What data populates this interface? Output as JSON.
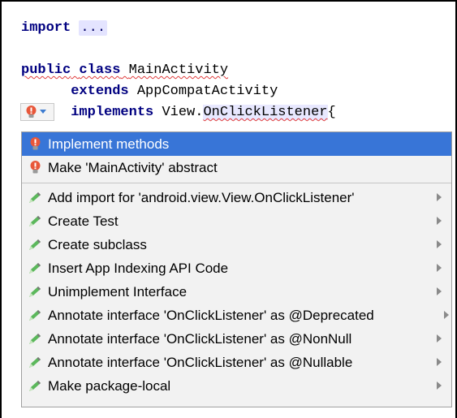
{
  "editor": {
    "line1": {
      "keyword": "import",
      "folded": "..."
    },
    "line2": {
      "keyword1": "public",
      "keyword2": "class",
      "classname": "MainActivity"
    },
    "line3": {
      "keyword": "extends",
      "name": "AppCompatActivity"
    },
    "line4": {
      "keyword": "implements",
      "prefix": "View.",
      "iface": "OnClickListener",
      "brace": "{"
    }
  },
  "popup": {
    "quickfix_items": [
      {
        "label": "Implement methods",
        "icon": "red-bulb-icon",
        "selected": true
      },
      {
        "label": "Make 'MainActivity' abstract",
        "icon": "red-bulb-icon",
        "selected": false
      }
    ],
    "intention_items": [
      {
        "label": "Add import for 'android.view.View.OnClickListener'",
        "icon": "pencil-icon"
      },
      {
        "label": "Create Test",
        "icon": "pencil-icon"
      },
      {
        "label": "Create subclass",
        "icon": "pencil-icon"
      },
      {
        "label": "Insert App Indexing API Code",
        "icon": "pencil-icon"
      },
      {
        "label": "Unimplement Interface",
        "icon": "pencil-icon"
      },
      {
        "label": "Annotate interface 'OnClickListener' as @Deprecated",
        "icon": "pencil-icon"
      },
      {
        "label": "Annotate interface 'OnClickListener' as @NonNull",
        "icon": "pencil-icon"
      },
      {
        "label": "Annotate interface 'OnClickListener' as @Nullable",
        "icon": "pencil-icon"
      },
      {
        "label": "Make package-local",
        "icon": "pencil-icon"
      }
    ]
  },
  "colors": {
    "keyword": "#000080",
    "selection": "#3875d7",
    "error_bulb": "#e8573a",
    "pencil_green": "#4caf50",
    "squiggle": "#e03c3c"
  }
}
